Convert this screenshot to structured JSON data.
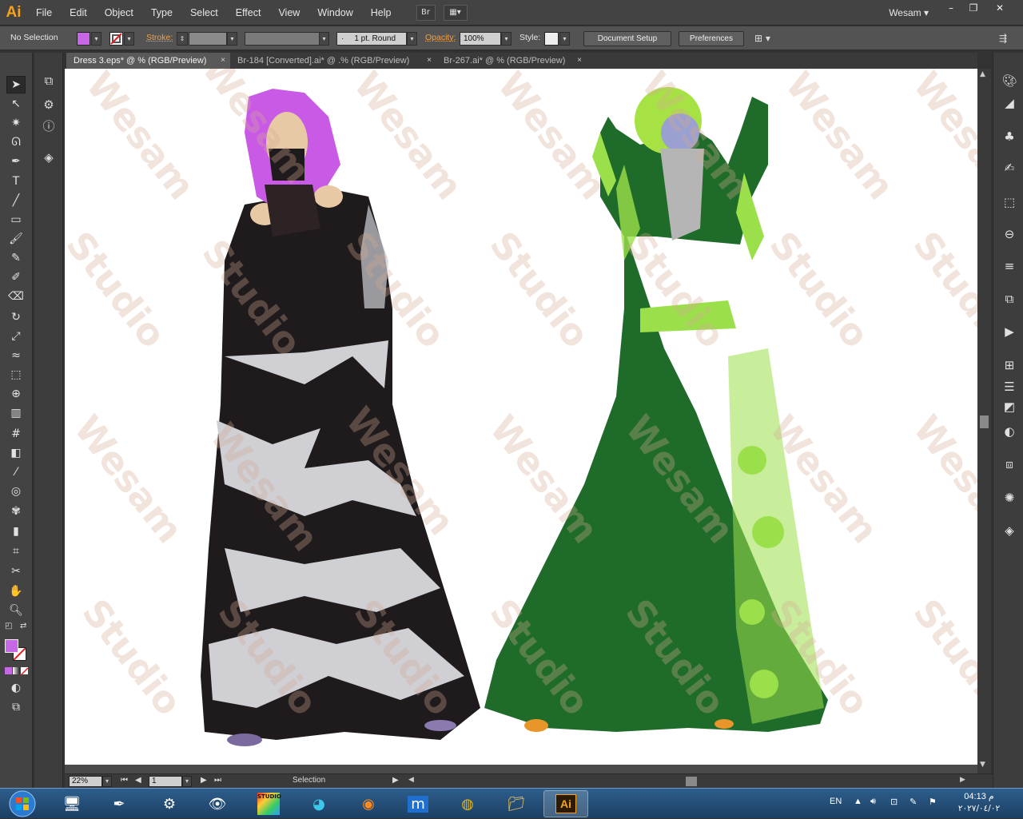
{
  "app": {
    "logo": "Ai",
    "user": "Wesam",
    "bridge_label": "Br"
  },
  "menu": [
    "File",
    "Edit",
    "Object",
    "Type",
    "Select",
    "Effect",
    "View",
    "Window",
    "Help"
  ],
  "window_controls": {
    "minimize": "–",
    "restore": "❐",
    "close": "✕"
  },
  "control_bar": {
    "selection_state": "No Selection",
    "stroke_label": "Stroke:",
    "brush_value": "1 pt. Round",
    "opacity_label": "Opacity:",
    "opacity_value": "100%",
    "style_label": "Style:",
    "document_setup": "Document Setup",
    "preferences": "Preferences",
    "fill_color": "#c667e6"
  },
  "tabs": [
    {
      "label": "Dress 3.eps* @ % (RGB/Preview)",
      "close": "×"
    },
    {
      "label": "Br-184 [Converted].ai* @ .% (RGB/Preview)",
      "close": "×"
    },
    {
      "label": "Br-267.ai* @ % (RGB/Preview)",
      "close": "×"
    }
  ],
  "status_bar": {
    "zoom": "22%",
    "page": "1",
    "tool_name": "Selection"
  },
  "watermark": {
    "line1": "Wesam",
    "line2": "Studio"
  },
  "taskbar": {
    "ai_label": "Ai",
    "studio_label": "STUDIO",
    "language": "EN",
    "time": "04:13 م",
    "date": "٢٠٢٧/٠٤/٠٢"
  },
  "colors": {
    "dress_left": "#1f1b1d",
    "lace": "#cfcfd4",
    "dress_right": "#1f6b2a",
    "dress_right_light": "#9be04a",
    "hair_left": "#c95ae6",
    "skin": "#e8c9a6"
  }
}
